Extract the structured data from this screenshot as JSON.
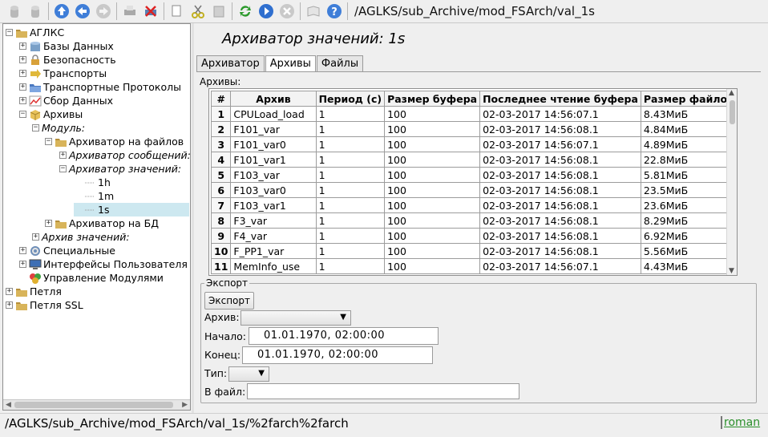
{
  "toolbar": {
    "path": "/AGLKS/sub_Archive/mod_FSArch/val_1s",
    "icons": [
      "db-up-icon",
      "db-down-icon",
      "up-arrow-icon",
      "back-icon",
      "forward-icon",
      "print-icon",
      "print-alarm-icon",
      "copy-icon",
      "cut-icon",
      "paste-icon",
      "refresh-icon",
      "play-icon",
      "stop-icon",
      "manual-icon",
      "help-icon"
    ]
  },
  "tree": {
    "items": [
      {
        "label": "АГЛКС",
        "exp": "−"
      },
      {
        "label": "Базы Данных",
        "exp": "+"
      },
      {
        "label": "Безопасность",
        "exp": "+"
      },
      {
        "label": "Транспорты",
        "exp": "+"
      },
      {
        "label": "Транспортные Протоколы",
        "exp": "+"
      },
      {
        "label": "Сбор Данных",
        "exp": "+"
      },
      {
        "label": "Архивы",
        "exp": "−"
      },
      {
        "label": "Модуль:",
        "exp": "−"
      },
      {
        "label": "Архиватор на файлов",
        "exp": "−"
      },
      {
        "label": "Архиватор сообщений:",
        "exp": "+"
      },
      {
        "label": "Архиватор значений:",
        "exp": "−"
      },
      {
        "label": "1h"
      },
      {
        "label": "1m"
      },
      {
        "label": "1s"
      },
      {
        "label": "Архиватор на БД",
        "exp": "+"
      },
      {
        "label": "Архив значений:",
        "exp": "+"
      },
      {
        "label": "Специальные",
        "exp": "+"
      },
      {
        "label": "Интерфейсы Пользователя",
        "exp": "+"
      },
      {
        "label": "Управление Модулями"
      },
      {
        "label": "Петля",
        "exp": "+"
      },
      {
        "label": "Петля SSL",
        "exp": "+"
      }
    ]
  },
  "main": {
    "title": "Архиватор значений: 1s",
    "tabs": [
      "Архиватор",
      "Архивы",
      "Файлы"
    ],
    "archives_label": "Архивы:",
    "table": {
      "headers": [
        "#",
        "Архив",
        "Период (с)",
        "Размер буфера",
        "Последнее чтение буфера",
        "Размер файлов"
      ],
      "rows": [
        [
          "1",
          "CPULoad_load",
          "1",
          "100",
          "02-03-2017 14:56:07.1",
          "8.43МиБ"
        ],
        [
          "2",
          "F101_var",
          "1",
          "100",
          "02-03-2017 14:56:08.1",
          "4.84МиБ"
        ],
        [
          "3",
          "F101_var0",
          "1",
          "100",
          "02-03-2017 14:56:07.1",
          "4.89МиБ"
        ],
        [
          "4",
          "F101_var1",
          "1",
          "100",
          "02-03-2017 14:56:08.1",
          "22.8МиБ"
        ],
        [
          "5",
          "F103_var",
          "1",
          "100",
          "02-03-2017 14:56:08.1",
          "5.81МиБ"
        ],
        [
          "6",
          "F103_var0",
          "1",
          "100",
          "02-03-2017 14:56:08.1",
          "23.5МиБ"
        ],
        [
          "7",
          "F103_var1",
          "1",
          "100",
          "02-03-2017 14:56:08.1",
          "23.6МиБ"
        ],
        [
          "8",
          "F3_var",
          "1",
          "100",
          "02-03-2017 14:56:08.1",
          "8.29МиБ"
        ],
        [
          "9",
          "F4_var",
          "1",
          "100",
          "02-03-2017 14:56:08.1",
          "6.92МиБ"
        ],
        [
          "10",
          "F_PP1_var",
          "1",
          "100",
          "02-03-2017 14:56:08.1",
          "5.56МиБ"
        ],
        [
          "11",
          "MemInfo_use",
          "1",
          "100",
          "02-03-2017 14:56:07.1",
          "4.43МиБ"
        ]
      ]
    },
    "export": {
      "group_title": "Экспорт",
      "button": "Экспорт",
      "archive_label": "Архив:",
      "archive_value": "",
      "start_label": "Начало:",
      "start_value": "01.01.1970, 02:00:00",
      "end_label": "Конец:",
      "end_value": "01.01.1970, 02:00:00",
      "type_label": "Тип:",
      "type_value": "",
      "file_label": "В файл:",
      "file_value": ""
    }
  },
  "status": {
    "path": "/AGLKS/sub_Archive/mod_FSArch/val_1s/%2farch%2farch",
    "user": "roman"
  }
}
